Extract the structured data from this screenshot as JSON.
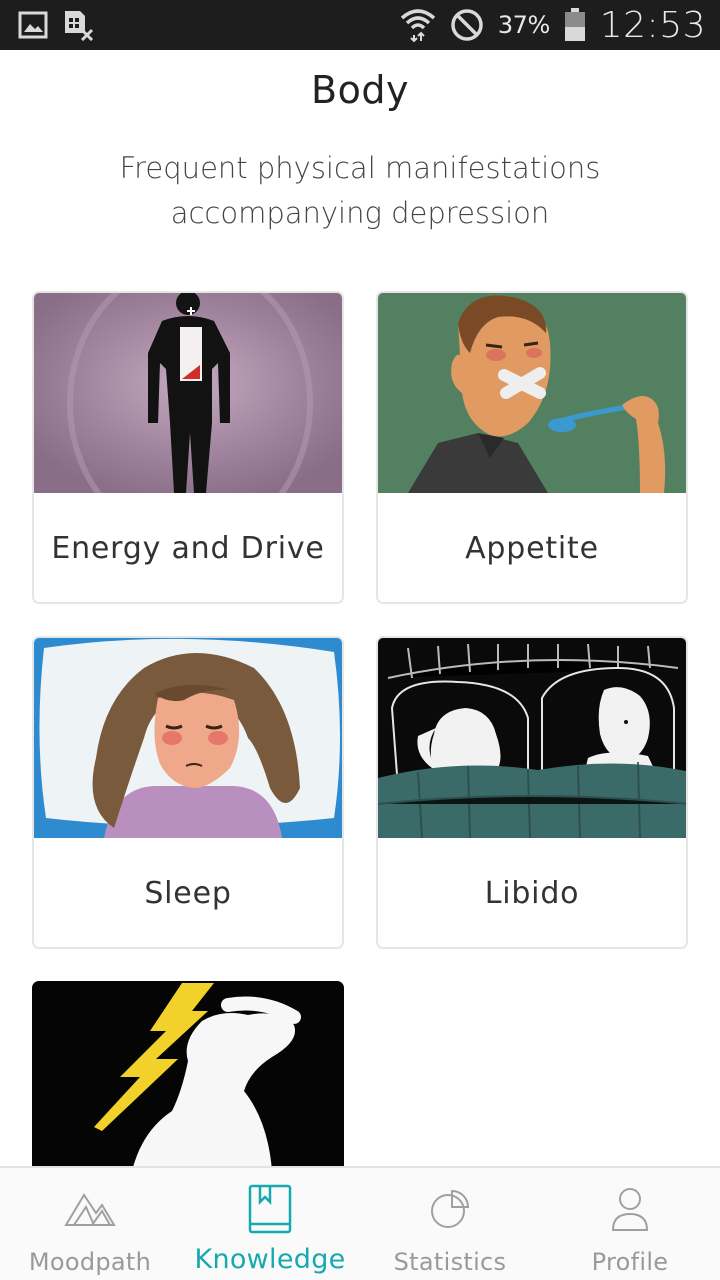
{
  "status_bar": {
    "battery_percent": "37%",
    "time": "12:53",
    "icons": [
      "gallery-icon",
      "sim-off-icon",
      "wifi-icon",
      "do-not-disturb-icon",
      "battery-icon"
    ]
  },
  "header": {
    "title": "Body",
    "subtitle": "Frequent physical manifestations accompanying depression"
  },
  "cards": [
    {
      "label": "Energy and Drive",
      "image": "battery-person-illustration"
    },
    {
      "label": "Appetite",
      "image": "taped-mouth-spoon-illustration"
    },
    {
      "label": "Sleep",
      "image": "tired-woman-pillow-illustration"
    },
    {
      "label": "Libido",
      "image": "couple-in-bed-illustration"
    },
    {
      "label": "",
      "image": "headache-lightning-illustration"
    }
  ],
  "bottom_nav": {
    "items": [
      {
        "label": "Moodpath",
        "icon": "mountains-icon",
        "active": false
      },
      {
        "label": "Knowledge",
        "icon": "book-icon",
        "active": true
      },
      {
        "label": "Statistics",
        "icon": "pie-chart-icon",
        "active": false
      },
      {
        "label": "Profile",
        "icon": "person-icon",
        "active": false
      }
    ],
    "active_color": "#17a9b0",
    "inactive_color": "#9a9a9a"
  }
}
